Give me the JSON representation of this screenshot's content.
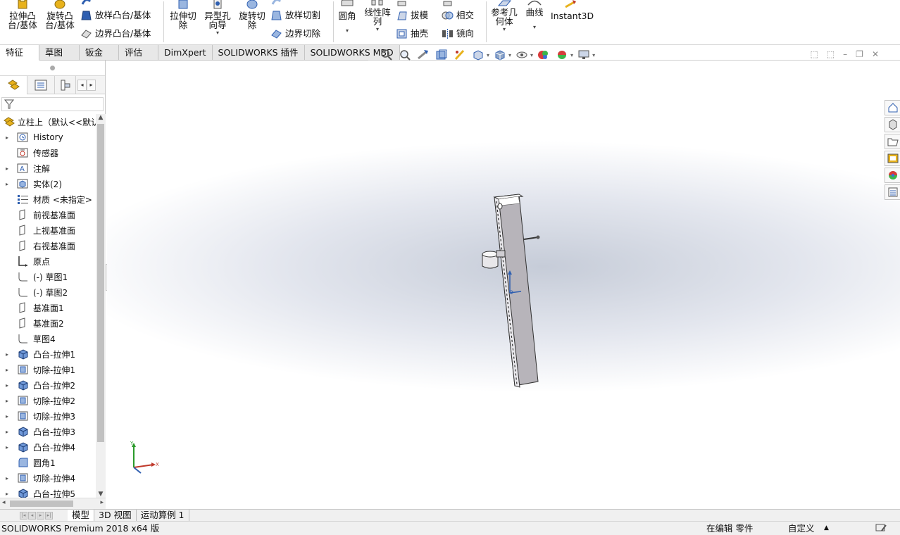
{
  "ribbon": {
    "big_buttons": [
      {
        "id": "extrude-boss",
        "label": "拉伸凸\n台/基体",
        "icon": "extrude-boss-icon"
      },
      {
        "id": "revolve-boss",
        "label": "旋转凸\n台/基体",
        "icon": "revolve-boss-icon"
      },
      {
        "id": "extrude-cut",
        "label": "拉伸切\n除",
        "icon": "extrude-cut-icon"
      },
      {
        "id": "hole-wizard",
        "label": "异型孔\n向导",
        "icon": "hole-wizard-icon",
        "dropdown": true
      },
      {
        "id": "revolve-cut",
        "label": "旋转切\n除",
        "icon": "revolve-cut-icon"
      },
      {
        "id": "fillet",
        "label": "圆角",
        "icon": "fillet-icon",
        "dropdown": true
      },
      {
        "id": "linear-pattern",
        "label": "线性阵\n列",
        "icon": "linear-pattern-icon",
        "dropdown": true
      },
      {
        "id": "reference-geometry",
        "label": "参考几\n何体",
        "icon": "reference-geometry-icon",
        "dropdown": true
      },
      {
        "id": "curves",
        "label": "曲线",
        "icon": "curves-icon",
        "dropdown": true
      },
      {
        "id": "instant3d",
        "label": "Instant3D",
        "icon": "instant3d-icon"
      }
    ],
    "small_buttons": [
      {
        "id": "loft-boss",
        "label": "放样凸台/基体",
        "icon": "loft-boss-icon"
      },
      {
        "id": "boundary-boss",
        "label": "边界凸台/基体",
        "icon": "boundary-boss-icon"
      },
      {
        "id": "lofted-cut",
        "label": "放样切割",
        "icon": "lofted-cut-icon"
      },
      {
        "id": "boundary-cut",
        "label": "边界切除",
        "icon": "boundary-cut-icon"
      },
      {
        "id": "draft",
        "label": "拔模",
        "icon": "draft-icon"
      },
      {
        "id": "shell",
        "label": "抽壳",
        "icon": "shell-icon"
      },
      {
        "id": "intersect",
        "label": "相交",
        "icon": "intersect-icon"
      },
      {
        "id": "mirror",
        "label": "镜向",
        "icon": "mirror-icon"
      }
    ]
  },
  "command_tabs": [
    "特征",
    "草图",
    "钣金",
    "评估",
    "DimXpert",
    "SOLIDWORKS 插件",
    "SOLIDWORKS MBD"
  ],
  "command_tabs_active": 0,
  "heads_up": [
    "zoom-to-fit-icon",
    "zoom-to-area-icon",
    "previous-view-icon",
    "section-view-icon",
    "dynamic-annotation-icon",
    "view-orientation-icon",
    "display-style-icon",
    "hide-show-items-icon",
    "edit-appearance-icon",
    "apply-scene-icon",
    "view-settings-icon"
  ],
  "panel": {
    "tabs": [
      "featuremanager-tab-icon",
      "propertymanager-tab-icon",
      "configurationmanager-tab-icon"
    ],
    "root_label": "立柱上（默认<<默认",
    "tree": [
      {
        "label": "History",
        "icon": "history-icon",
        "expandable": true
      },
      {
        "label": "传感器",
        "icon": "sensors-icon",
        "expandable": false
      },
      {
        "label": "注解",
        "icon": "annotations-icon",
        "expandable": true
      },
      {
        "label": "实体(2)",
        "icon": "solid-bodies-icon",
        "expandable": true
      },
      {
        "label": "材质 <未指定>",
        "icon": "material-icon",
        "expandable": false
      },
      {
        "label": "前视基准面",
        "icon": "plane-icon",
        "expandable": false
      },
      {
        "label": "上视基准面",
        "icon": "plane-icon",
        "expandable": false
      },
      {
        "label": "右视基准面",
        "icon": "plane-icon",
        "expandable": false
      },
      {
        "label": "原点",
        "icon": "origin-icon",
        "expandable": false
      },
      {
        "label": "(-) 草图1",
        "icon": "sketch-icon",
        "expandable": false
      },
      {
        "label": "(-) 草图2",
        "icon": "sketch-icon",
        "expandable": false
      },
      {
        "label": "基准面1",
        "icon": "plane-icon",
        "expandable": false
      },
      {
        "label": "基准面2",
        "icon": "plane-icon",
        "expandable": false
      },
      {
        "label": "草图4",
        "icon": "sketch-icon",
        "expandable": false
      },
      {
        "label": "凸台-拉伸1",
        "icon": "extrude-boss-icon",
        "expandable": true
      },
      {
        "label": "切除-拉伸1",
        "icon": "extrude-cut-icon",
        "expandable": true
      },
      {
        "label": "凸台-拉伸2",
        "icon": "extrude-boss-icon",
        "expandable": true
      },
      {
        "label": "切除-拉伸2",
        "icon": "extrude-cut-icon",
        "expandable": true
      },
      {
        "label": "切除-拉伸3",
        "icon": "extrude-cut-icon",
        "expandable": true
      },
      {
        "label": "凸台-拉伸3",
        "icon": "extrude-boss-icon",
        "expandable": true
      },
      {
        "label": "凸台-拉伸4",
        "icon": "extrude-boss-icon",
        "expandable": true
      },
      {
        "label": "圆角1",
        "icon": "fillet-icon",
        "expandable": false
      },
      {
        "label": "切除-拉伸4",
        "icon": "extrude-cut-icon",
        "expandable": true
      },
      {
        "label": "凸台-拉伸5",
        "icon": "extrude-boss-icon",
        "expandable": true
      }
    ]
  },
  "viewport": {
    "triad": {
      "x": "X",
      "y": "Y"
    }
  },
  "task_pane": [
    "solidworks-resources-icon",
    "design-library-icon",
    "file-explorer-icon",
    "view-palette-icon",
    "appearances-icon",
    "custom-properties-icon"
  ],
  "model_tabs": [
    "模型",
    "3D 视图",
    "运动算例 1"
  ],
  "model_tabs_active": 0,
  "status": {
    "app": "SOLIDWORKS Premium 2018 x64 版",
    "mode": "在编辑 零件",
    "units": "自定义",
    "units_arrow": "▲"
  },
  "colors": {
    "accent_blue": "#2f5fb0",
    "icon_gold": "#e8b21c",
    "part_gray": "#b5b2b8"
  }
}
